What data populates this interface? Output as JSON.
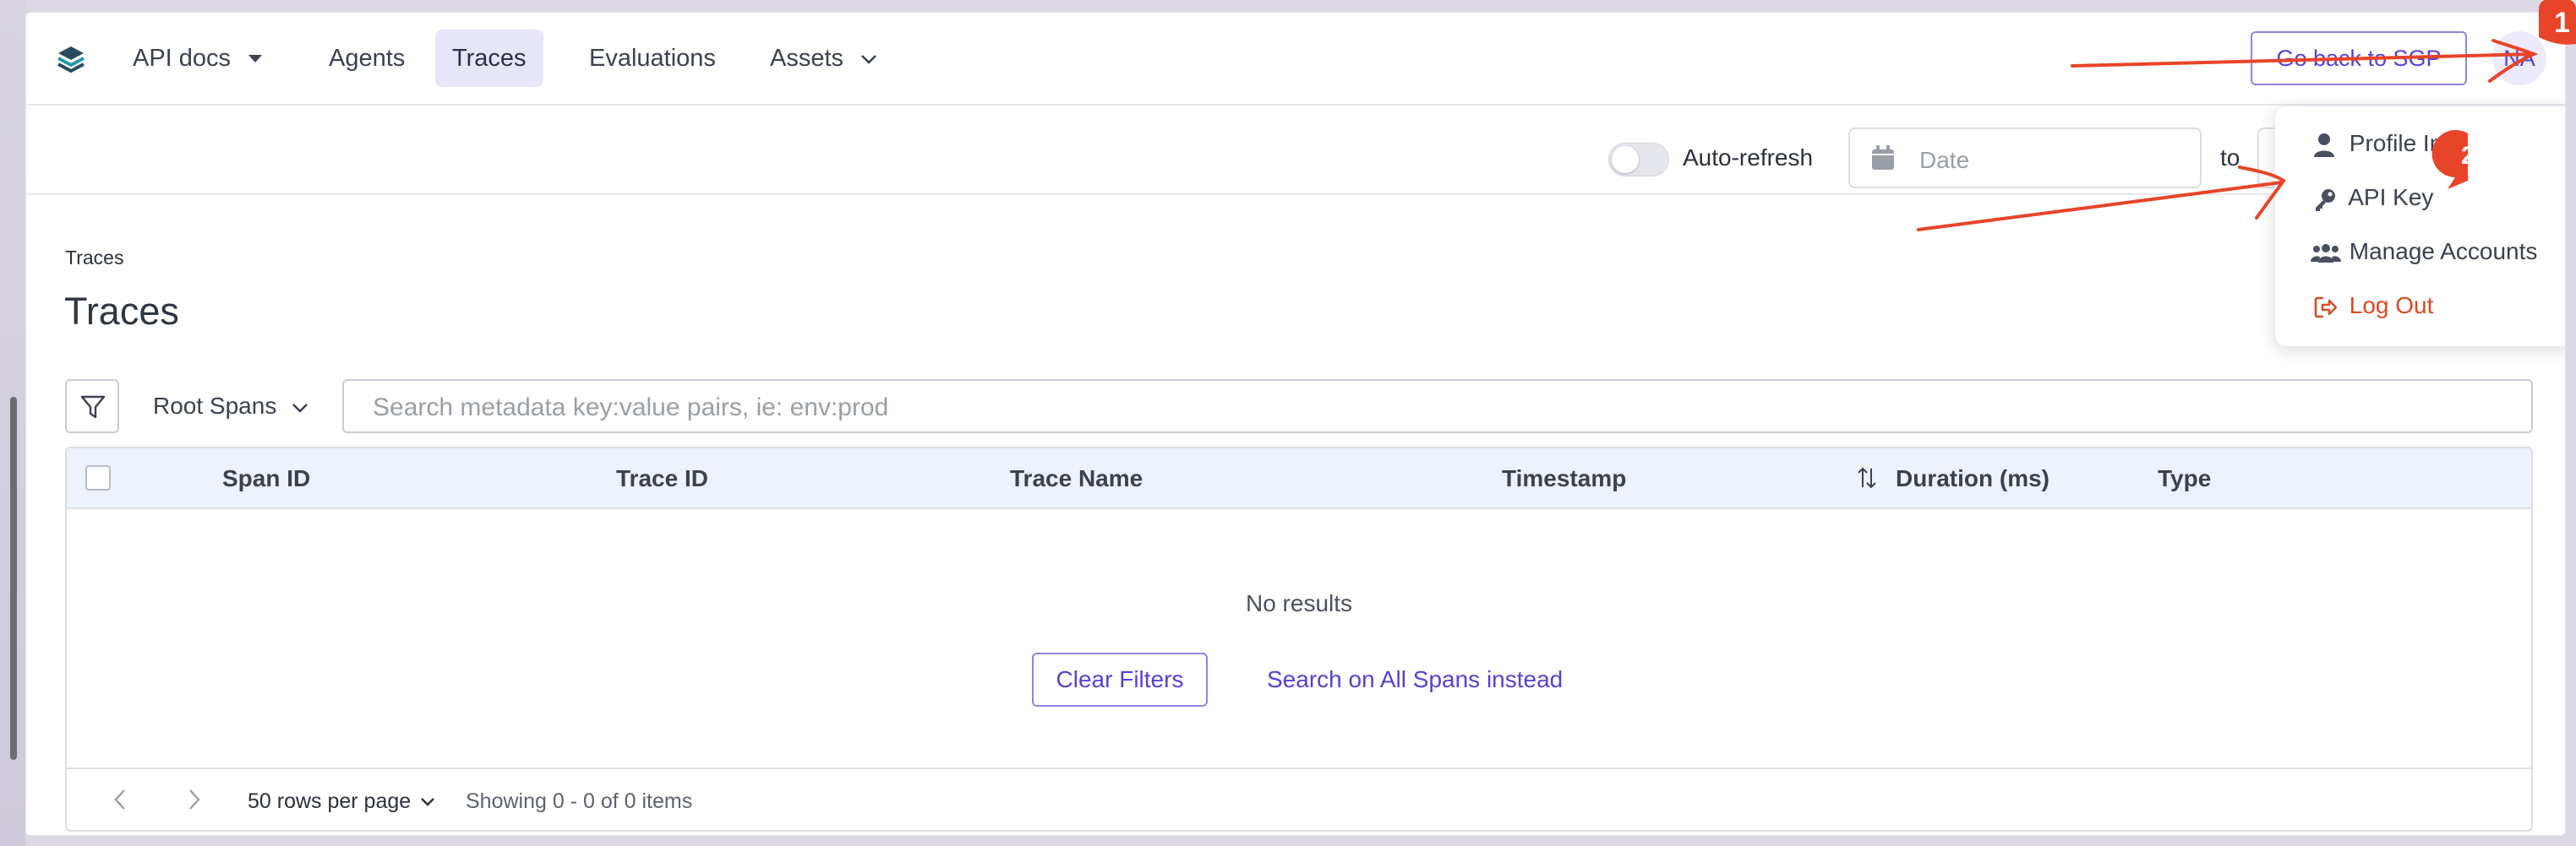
{
  "nav": {
    "items": [
      {
        "label": "API docs",
        "has_caret": true
      },
      {
        "label": "Agents"
      },
      {
        "label": "Traces",
        "active": true
      },
      {
        "label": "Evaluations"
      },
      {
        "label": "Assets",
        "has_caret": true
      }
    ],
    "go_back_label": "Go back to SGP",
    "avatar_initials": "NA"
  },
  "toolbar": {
    "auto_refresh_label": "Auto-refresh",
    "auto_refresh_on": false,
    "date_placeholder": "Date",
    "to_label": "to"
  },
  "user_menu": {
    "items": [
      {
        "label": "Profile Info",
        "icon": "user-icon"
      },
      {
        "label": "API Key",
        "icon": "key-icon"
      },
      {
        "label": "Manage Accounts",
        "icon": "users-icon"
      },
      {
        "label": "Log Out",
        "icon": "logout-icon"
      }
    ]
  },
  "page": {
    "breadcrumb": "Traces",
    "title": "Traces",
    "span_filter": "Root Spans",
    "search_placeholder": "Search metadata key:value pairs, ie: env:prod"
  },
  "table": {
    "columns": [
      "Span ID",
      "Trace ID",
      "Trace Name",
      "Timestamp",
      "Duration (ms)",
      "Type"
    ],
    "empty_text": "No results",
    "clear_filters_label": "Clear Filters",
    "search_all_label": "Search on All Spans instead",
    "rows_per_page": "50 rows per page",
    "showing_text": "Showing 0 - 0 of 0 items"
  },
  "annotations": {
    "badge_1": "1",
    "badge_2": "2",
    "color": "#e8442a"
  },
  "colors": {
    "accent": "#5a3fd3",
    "active_tab_bg": "#e7e6fb",
    "logout": "#d84a22",
    "table_header_bg": "#eef2fb"
  }
}
